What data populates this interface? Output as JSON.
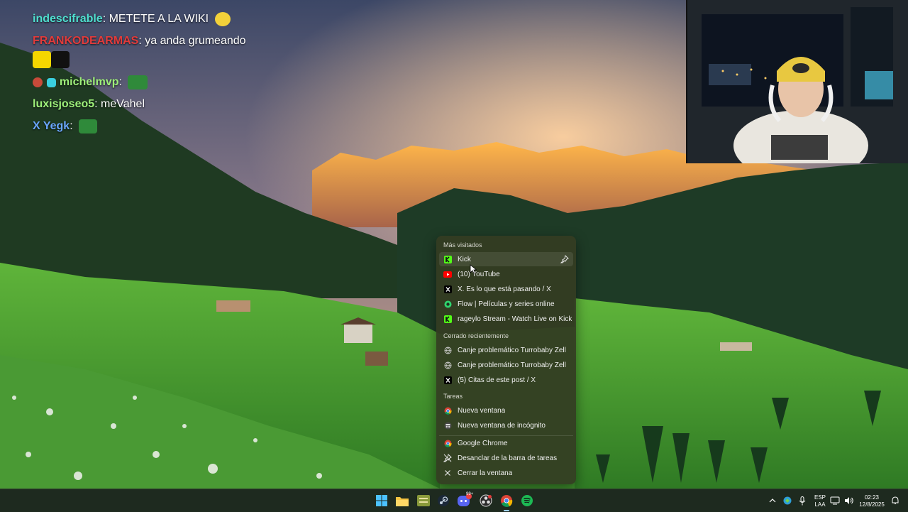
{
  "chat": {
    "messages": [
      {
        "user": "indescifrable",
        "text": ": METETE A LA WIKI",
        "color": "#4fe0d0"
      },
      {
        "user": "FRANKODEARMAS",
        "text": ": ya anda grumeando",
        "color": "#e23b3b"
      },
      {
        "user": "michelmvp",
        "text": ":",
        "color": "#9ef07a"
      },
      {
        "user": "luxisjoseo5",
        "text": ": meVahel",
        "color": "#9ef07a"
      },
      {
        "user": "X Yegk",
        "text": ":",
        "color": "#6aa6ff"
      }
    ]
  },
  "jumplist": {
    "sections": {
      "most_visited": "Más visitados",
      "recently_closed": "Cerrado recientemente",
      "tasks": "Tareas"
    },
    "most_visited": [
      {
        "label": "Kick",
        "icon": "kick-icon",
        "color": "#53fc18"
      },
      {
        "label": "(10) YouTube",
        "icon": "youtube-icon",
        "color": "#ff0000"
      },
      {
        "label": "X. Es lo que está pasando / X",
        "icon": "x-icon",
        "color": "#000000"
      },
      {
        "label": "Flow | Películas y series online",
        "icon": "flow-icon",
        "color": "#2fd46e"
      },
      {
        "label": "rageylo Stream - Watch Live on Kick",
        "icon": "kick-icon",
        "color": "#53fc18"
      }
    ],
    "recently_closed": [
      {
        "label": "Canje problemático Turrobaby Zell",
        "icon": "globe-icon"
      },
      {
        "label": "Canje problemático Turrobaby Zell",
        "icon": "globe-icon"
      },
      {
        "label": "(5) Citas de este post / X",
        "icon": "x-icon"
      }
    ],
    "tasks": [
      {
        "label": "Nueva ventana",
        "icon": "chrome-icon"
      },
      {
        "label": "Nueva ventana de incógnito",
        "icon": "incognito-icon"
      }
    ],
    "app": [
      {
        "label": "Google Chrome",
        "icon": "chrome-icon"
      },
      {
        "label": "Desanclar de la barra de tareas",
        "icon": "unpin-icon"
      },
      {
        "label": "Cerrar la ventana",
        "icon": "close-icon"
      }
    ]
  },
  "taskbar": {
    "apps": [
      "windows-start-icon",
      "file-explorer-icon",
      "app-icon",
      "steam-icon",
      "discord-icon",
      "obs-icon",
      "chrome-icon",
      "spotify-icon"
    ],
    "discord_badge": "99+",
    "language": "ESP",
    "layout": "LAA",
    "time": "02:23",
    "date": "12/8/2025"
  },
  "colors": {
    "accent": "#9fd0ff",
    "jumplist_bg": "#343c22",
    "taskbar_bg": "#1e2a1f"
  }
}
